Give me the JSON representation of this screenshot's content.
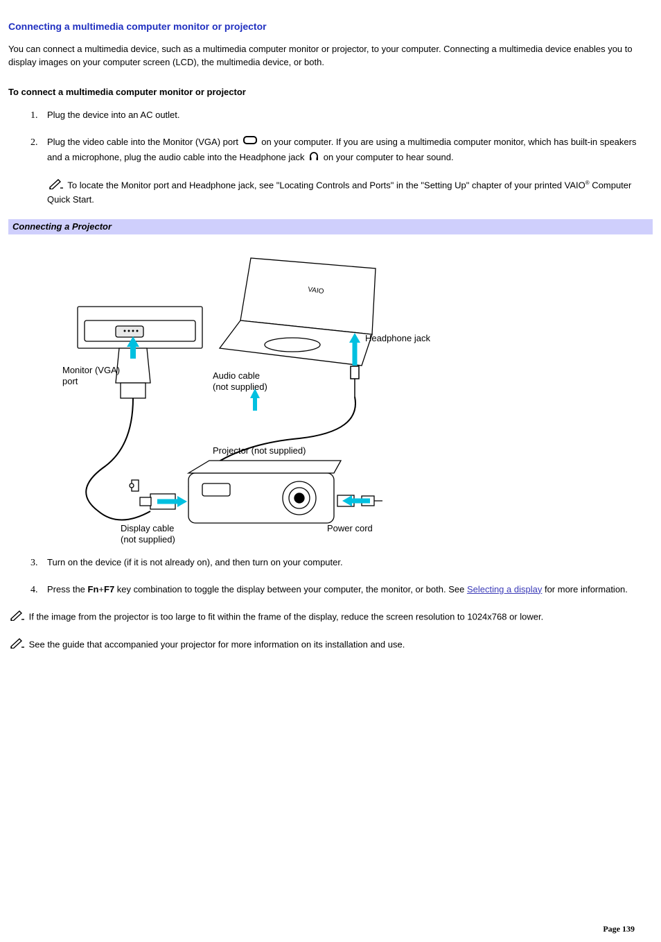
{
  "title": "Connecting a multimedia computer monitor or projector",
  "intro": "You can connect a multimedia device, such as a multimedia computer monitor or projector, to your computer. Connecting a multimedia device enables you to display images on your computer screen (LCD), the multimedia device, or both.",
  "subhead": "To connect a multimedia computer monitor or projector",
  "steps": {
    "s1": "Plug the device into an AC outlet.",
    "s2a": "Plug the video cable into the Monitor (VGA) port ",
    "s2b": " on your computer. If you are using a multimedia computer monitor, which has built-in speakers and a microphone, plug the audio cable into the Headphone jack ",
    "s2c": " on your computer to hear sound.",
    "s3": "Turn on the device (if it is not already on), and then turn on your computer.",
    "s4a": "Press the ",
    "s4_fn": "Fn",
    "s4_plus": "+",
    "s4_f7": "F7",
    "s4b": " key combination to toggle the display between your computer, the monitor, or both. See ",
    "s4_link": "Selecting a display",
    "s4c": " for more information."
  },
  "note1a": " To locate the Monitor port and Headphone jack, see \"Locating Controls and Ports\" in the \"Setting Up\" chapter of your printed VAIO",
  "note1b": " Computer Quick Start.",
  "figcaption": "Connecting a Projector",
  "figlabels": {
    "headphone": "Headphone jack",
    "vga1": "Monitor (VGA)",
    "vga2": "port",
    "audio1": "Audio cable",
    "audio2": "(not supplied)",
    "projector": "Projector (not supplied)",
    "display1": "Display cable",
    "display2": "(not supplied)",
    "power": "Power cord"
  },
  "note2": " If the image from the projector is too large to fit within the frame of the display, reduce the screen resolution to 1024x768 or lower.",
  "note3": " See the guide that accompanied your projector for more information on its installation and use.",
  "pagenum": "Page 139",
  "reg": "®"
}
